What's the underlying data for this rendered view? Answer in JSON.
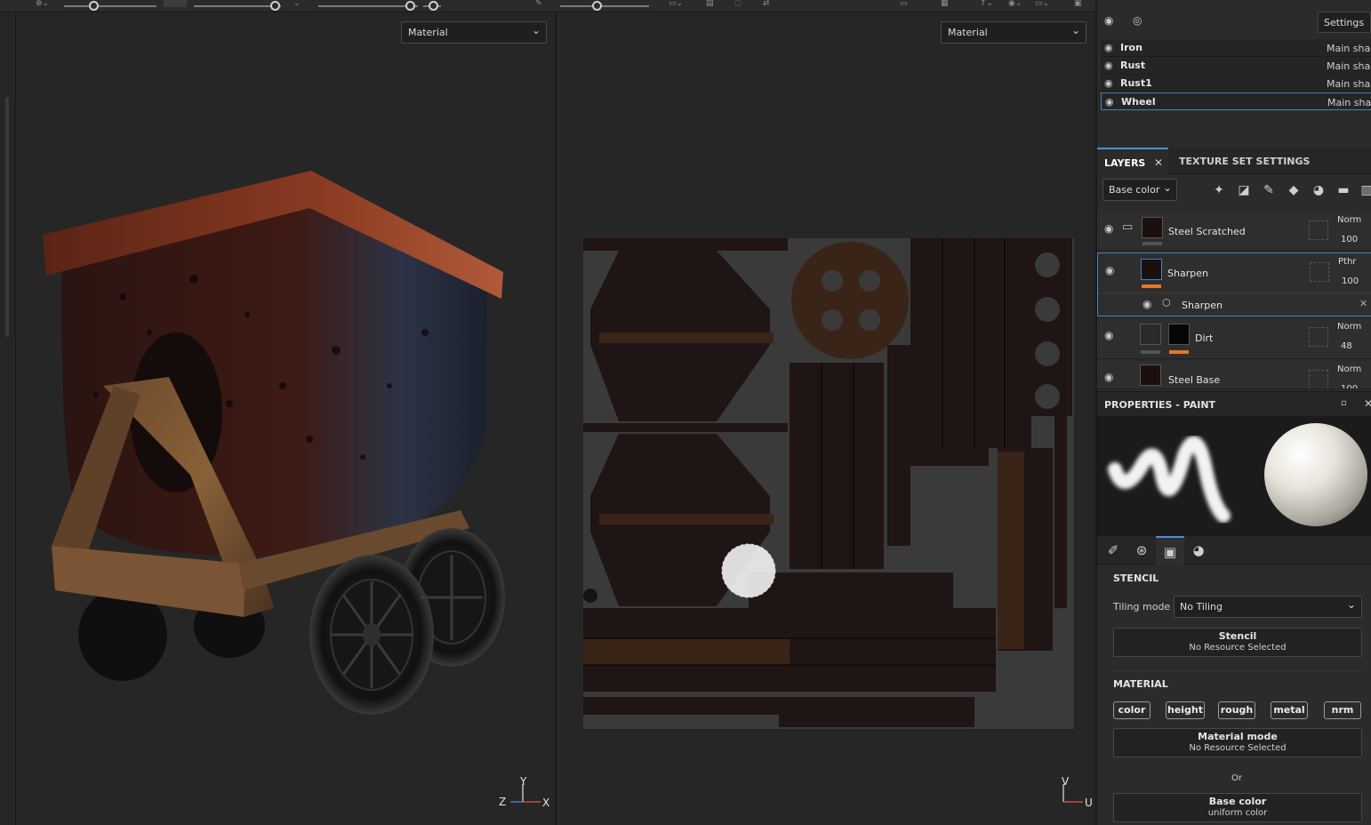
{
  "viewport_3d": {
    "material_select": "Material",
    "axes": {
      "y": "Y",
      "z": "Z",
      "x": "X"
    }
  },
  "viewport_2d": {
    "material_select": "Material",
    "axes": {
      "v": "V",
      "u": "U"
    }
  },
  "texture_sets": {
    "settings_button": "Settings",
    "rows": [
      {
        "name": "Iron",
        "shader": "Main shader"
      },
      {
        "name": "Rust",
        "shader": "Main shader"
      },
      {
        "name": "Rust1",
        "shader": "Main shader"
      },
      {
        "name": "Wheel",
        "shader": "Main shader",
        "selected": true
      }
    ]
  },
  "tabs": {
    "layers": "LAYERS",
    "texture_set_settings": "TEXTURE SET SETTINGS"
  },
  "layers_panel": {
    "channel": "Base color",
    "layers": [
      {
        "name": "Steel Scratched",
        "blend": "Norm",
        "opacity": "100"
      },
      {
        "name": "Sharpen",
        "blend": "Pthr",
        "opacity": "100",
        "effect": "Sharpen"
      },
      {
        "name": "Dirt",
        "blend": "Norm",
        "opacity": "48"
      },
      {
        "name": "Steel Base",
        "blend": "Norm",
        "opacity": "100"
      }
    ]
  },
  "properties": {
    "title": "PROPERTIES - PAINT",
    "stencil": {
      "section": "STENCIL",
      "tiling_label": "Tiling mode",
      "tiling_value": "No Tiling",
      "box_title": "Stencil",
      "box_value": "No Resource Selected"
    },
    "material": {
      "section": "MATERIAL",
      "channels": [
        "color",
        "height",
        "rough",
        "metal",
        "nrm"
      ],
      "mode_title": "Material mode",
      "mode_value": "No Resource Selected",
      "or_label": "Or",
      "base_title": "Base color",
      "base_value": "uniform color"
    }
  }
}
